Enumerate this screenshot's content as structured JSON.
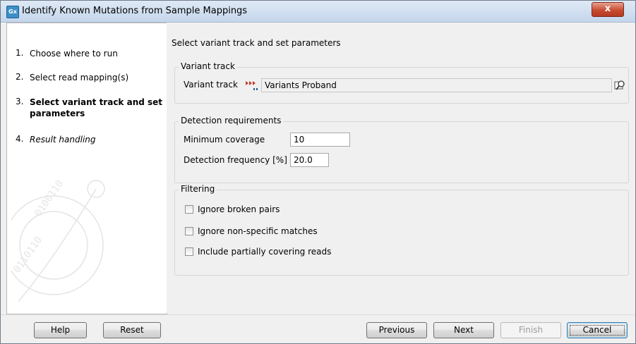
{
  "window": {
    "title": "Identify Known Mutations from Sample Mappings",
    "app_icon_text": "Gx",
    "close_symbol": "x"
  },
  "steps": [
    {
      "num": "1.",
      "label": "Choose where to run",
      "style": "normal"
    },
    {
      "num": "2.",
      "label": "Select read mapping(s)",
      "style": "normal"
    },
    {
      "num": "3.",
      "label": "Select variant track and set parameters",
      "style": "active"
    },
    {
      "num": "4.",
      "label": "Result handling",
      "style": "italic"
    }
  ],
  "content": {
    "heading": "Select variant track and set parameters",
    "variant_track_group": {
      "title": "Variant track",
      "label": "Variant track",
      "track_icon": "variant-track-icon",
      "value": "Variants Proband",
      "browse_icon": "browse-search-icon"
    },
    "detection_group": {
      "title": "Detection requirements",
      "min_coverage_label": "Minimum coverage",
      "min_coverage_value": "10",
      "frequency_label": "Detection frequency [%]",
      "frequency_value": "20.0"
    },
    "filtering_group": {
      "title": "Filtering",
      "options": [
        {
          "label": "Ignore broken pairs",
          "checked": false
        },
        {
          "label": "Ignore non-specific matches",
          "checked": false
        },
        {
          "label": "Include partially covering reads",
          "checked": false
        }
      ]
    }
  },
  "buttons": {
    "help": "Help",
    "reset": "Reset",
    "previous": "Previous",
    "next": "Next",
    "finish": "Finish",
    "cancel": "Cancel"
  },
  "colors": {
    "accent": "#3c7fb1",
    "close_button": "#c84b32",
    "variant_icon": "#c0392b"
  }
}
